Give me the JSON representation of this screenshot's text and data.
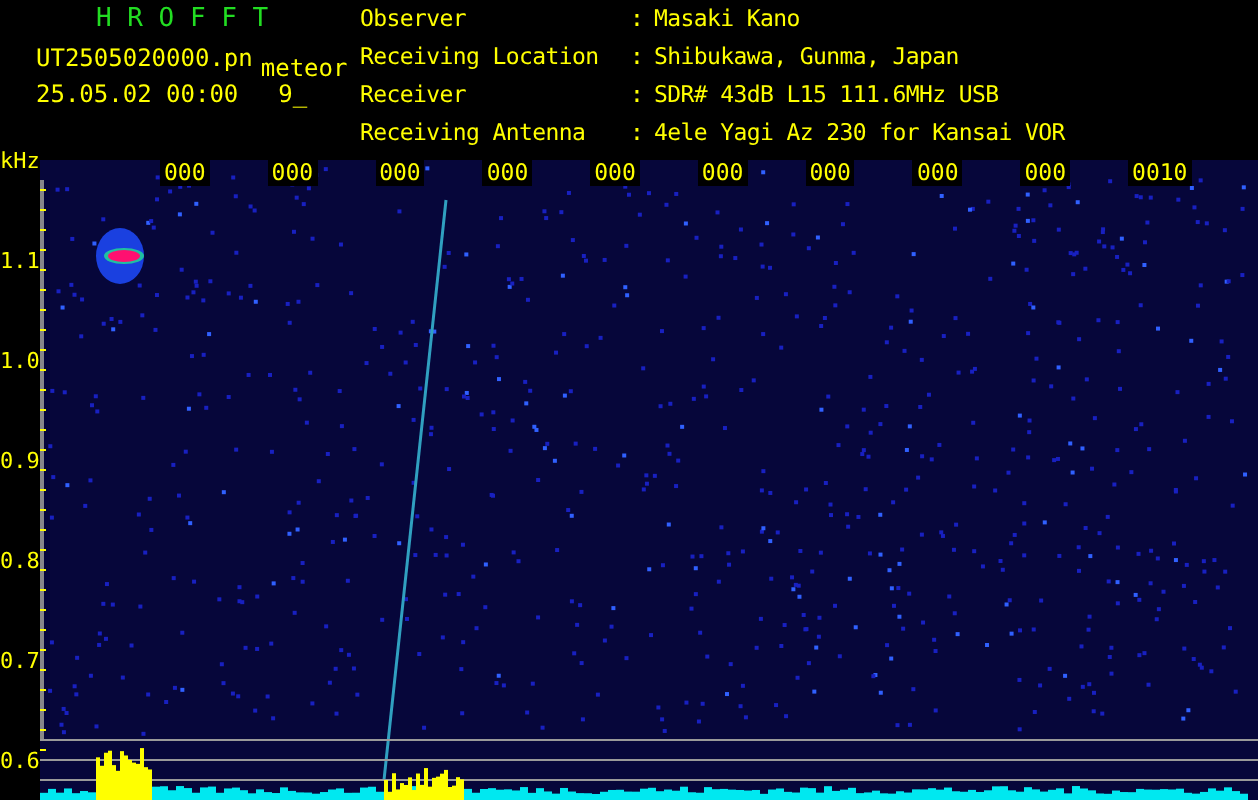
{
  "header": {
    "title": "H R O F F T",
    "filename": "UT2505020000.pn",
    "detection_label": "meteor",
    "timestamp": "25.05.02 00:00",
    "count": "9_"
  },
  "info": [
    {
      "label": "Observer",
      "separator": ":",
      "value": "Masaki Kano"
    },
    {
      "label": "Receiving Location",
      "separator": ":",
      "value": "Shibukawa, Gunma, Japan"
    },
    {
      "label": "Receiver",
      "separator": ":",
      "value": "SDR# 43dB L15 111.6MHz USB"
    },
    {
      "label": "Receiving Antenna",
      "separator": ":",
      "value": "4ele Yagi Az 230 for Kansai VOR"
    }
  ],
  "y_axis": {
    "unit": "kHz",
    "ticks": [
      "1.1",
      "1.0",
      "0.9",
      "0.8",
      "0.7",
      "0.6"
    ]
  },
  "time_labels": [
    "000",
    "000",
    "000",
    "000",
    "000",
    "000",
    "000",
    "000",
    "000",
    "0010"
  ]
}
